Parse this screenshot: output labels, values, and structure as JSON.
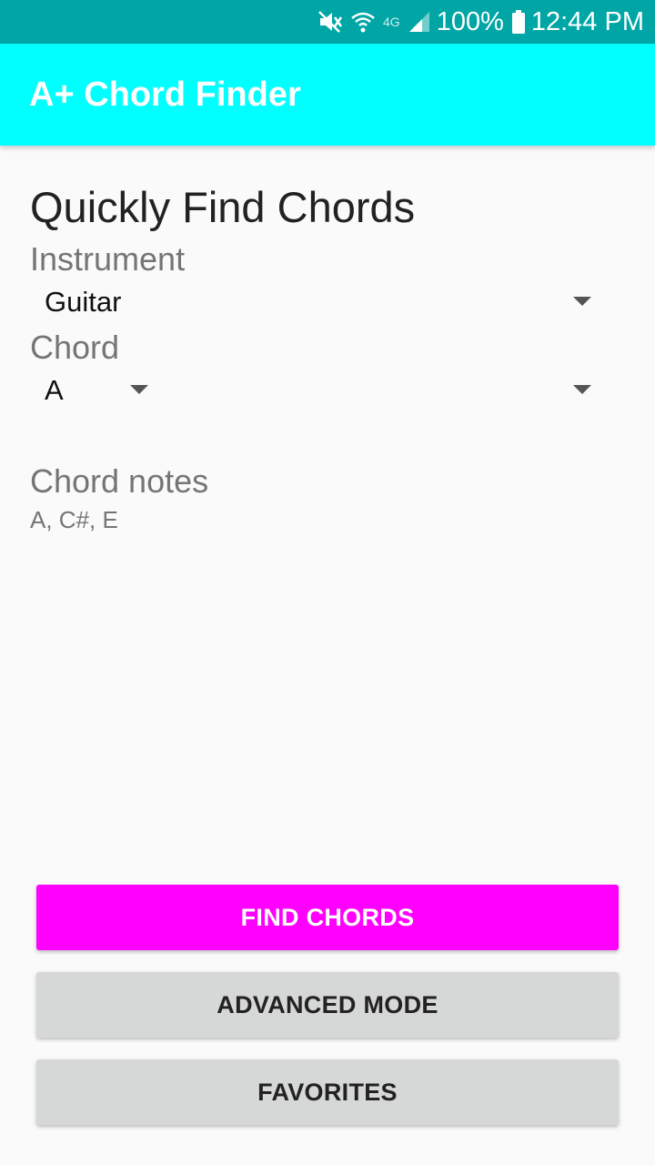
{
  "status_bar": {
    "battery": "100%",
    "time": "12:44 PM",
    "network": "4G",
    "icons": [
      "mute-icon",
      "wifi-icon",
      "signal-icon",
      "battery-icon"
    ]
  },
  "app_bar": {
    "title": "A+ Chord Finder",
    "color": "#00ffff"
  },
  "main": {
    "heading": "Quickly Find Chords",
    "instrument_label": "Instrument",
    "instrument_value": "Guitar",
    "chord_label": "Chord",
    "chord_value": "A",
    "notes_label": "Chord notes",
    "notes_value": "A, C#, E"
  },
  "buttons": {
    "find": "FIND CHORDS",
    "advanced": "ADVANCED MODE",
    "favorites": "FAVORITES"
  },
  "colors": {
    "status_bar": "#00a5a5",
    "accent": "#ff00ff",
    "secondary_button": "#d6d7d7"
  }
}
